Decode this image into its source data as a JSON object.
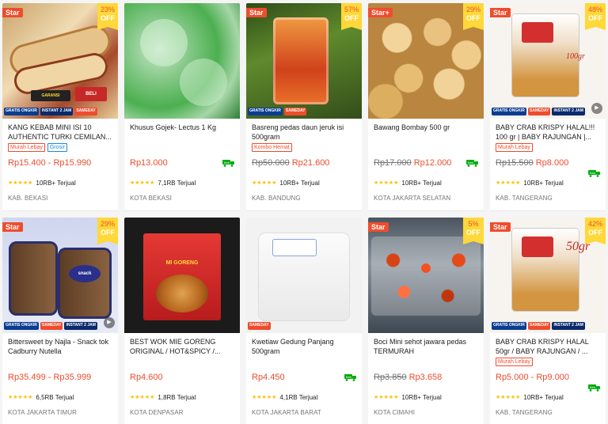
{
  "colors": {
    "accent": "#ee4d2d",
    "discount_bg": "#ffd839",
    "star": "#ffc107"
  },
  "products": [
    {
      "title": "KANG KEBAB MINI ISI 10 AUTHENTIC TURKI CEMILAN...",
      "star": "Star",
      "discount": "23%",
      "discount_off": "OFF",
      "tags": [
        "Murah Lebay",
        "Grosir"
      ],
      "orig_price": "",
      "price": "Rp15.400 - Rp15.990",
      "stars": "★★★★★",
      "sold": "10RB+ Terjual",
      "location": "KAB. BEKASI",
      "image_icon": "kebab-photo",
      "bottom_badges": [
        "GRATIS ONGKIR",
        "INSTANT 2 JAM",
        "SAMEDAY"
      ],
      "truck": false,
      "play": false
    },
    {
      "title": "Khusus Gojek- Lectus 1 Kg",
      "star": "",
      "discount": "",
      "discount_off": "",
      "tags": [],
      "orig_price": "",
      "price": "Rp13.000",
      "stars": "★★★★★",
      "sold": "7,1RB Terjual",
      "location": "KOTA BEKASI",
      "image_icon": "lettuce-photo",
      "bottom_badges": [],
      "truck": true,
      "play": false
    },
    {
      "title": "Basreng pedas daun jeruk isi 500gram",
      "star": "Star",
      "discount": "57%",
      "discount_off": "OFF",
      "tags": [
        "Kombo Hemat"
      ],
      "orig_price": "Rp50.000",
      "price": "Rp21.600",
      "stars": "★★★★★",
      "sold": "10RB+ Terjual",
      "location": "KAB. BANDUNG",
      "image_icon": "basreng-photo",
      "bottom_badges": [
        "GRATIS ONGKIR",
        "SAMEDAY"
      ],
      "truck": false,
      "play": false
    },
    {
      "title": "Bawang Bombay 500 gr",
      "star": "Star+",
      "discount": "29%",
      "discount_off": "OFF",
      "tags": [],
      "orig_price": "Rp17.000",
      "price": "Rp12.000",
      "stars": "★★★★★",
      "sold": "10RB+ Terjual",
      "location": "KOTA JAKARTA SELATAN",
      "image_icon": "onion-photo",
      "bottom_badges": [],
      "truck": true,
      "play": false
    },
    {
      "title": "BABY CRAB KRISPY HALAL!!! 100 gr | BABY RAJUNGAN |...",
      "star": "Star",
      "discount": "48%",
      "discount_off": "OFF",
      "tags": [
        "Murah Lebay"
      ],
      "orig_price": "Rp15.500",
      "price": "Rp8.000",
      "stars": "★★★★★",
      "sold": "10RB+ Terjual",
      "location": "KAB. TANGERANG",
      "image_icon": "crab-snack-photo",
      "image_text": "100gr",
      "bottom_badges": [
        "GRATIS ONGKIR",
        "SAMEDAY",
        "INSTANT 2 JAM"
      ],
      "truck": true,
      "play": true
    },
    {
      "title": "Bittersweet by Najla - Snack tok Cadburry Nutella",
      "star": "Star",
      "discount": "29%",
      "discount_off": "OFF",
      "tags": [],
      "orig_price": "",
      "price": "Rp35.499 - Rp35.999",
      "stars": "★★★★★",
      "sold": "6,5RB Terjual",
      "location": "KOTA JAKARTA TIMUR",
      "image_icon": "snack-jar-photo",
      "bottom_badges": [
        "GRATIS ONGKIR",
        "SAMEDAY",
        "INSTANT 2 JAM"
      ],
      "truck": false,
      "play": true
    },
    {
      "title": "BEST WOK MIE GORENG ORIGINAL / HOT&SPICY /...",
      "star": "",
      "discount": "",
      "discount_off": "",
      "tags": [],
      "orig_price": "",
      "price": "Rp4.600",
      "stars": "★★★★★",
      "sold": "1,8RB Terjual",
      "location": "KOTA DENPASAR",
      "image_icon": "noodle-pack-photo",
      "bottom_badges": [],
      "truck": false,
      "play": false
    },
    {
      "title": "Kwetiaw Gedung Panjang 500gram",
      "star": "",
      "discount": "",
      "discount_off": "",
      "tags": [],
      "orig_price": "",
      "price": "Rp4.450",
      "stars": "★★★★★",
      "sold": "4,1RB Terjual",
      "location": "KOTA JAKARTA BARAT",
      "image_icon": "kwetiaw-photo",
      "bottom_badges": [
        "SAMEDAY"
      ],
      "truck": true,
      "play": false
    },
    {
      "title": "Boci Mini sehot jawara pedas TERMURAH",
      "star": "Star",
      "discount": "5%",
      "discount_off": "OFF",
      "tags": [],
      "orig_price": "Rp3.850",
      "price": "Rp3.658",
      "stars": "★★★★★",
      "sold": "10RB+ Terjual",
      "location": "KOTA CIMAHI",
      "image_icon": "boci-photo",
      "bottom_badges": [],
      "truck": false,
      "play": false
    },
    {
      "title": "BABY CRAB KRISPY HALAL 50gr / BABY RAJUNGAN / ...",
      "star": "Star",
      "discount": "42%",
      "discount_off": "OFF",
      "tags": [
        "Murah Lebay"
      ],
      "orig_price": "",
      "price": "Rp5.000 - Rp9.000",
      "stars": "★★★★★",
      "sold": "10RB+ Terjual",
      "location": "KAB. TANGERANG",
      "image_icon": "crab-snack-photo",
      "image_text": "50gr",
      "bottom_badges": [
        "GRATIS ONGKIR",
        "SAMEDAY",
        "INSTANT 2 JAM"
      ],
      "truck": true,
      "play": false
    }
  ]
}
